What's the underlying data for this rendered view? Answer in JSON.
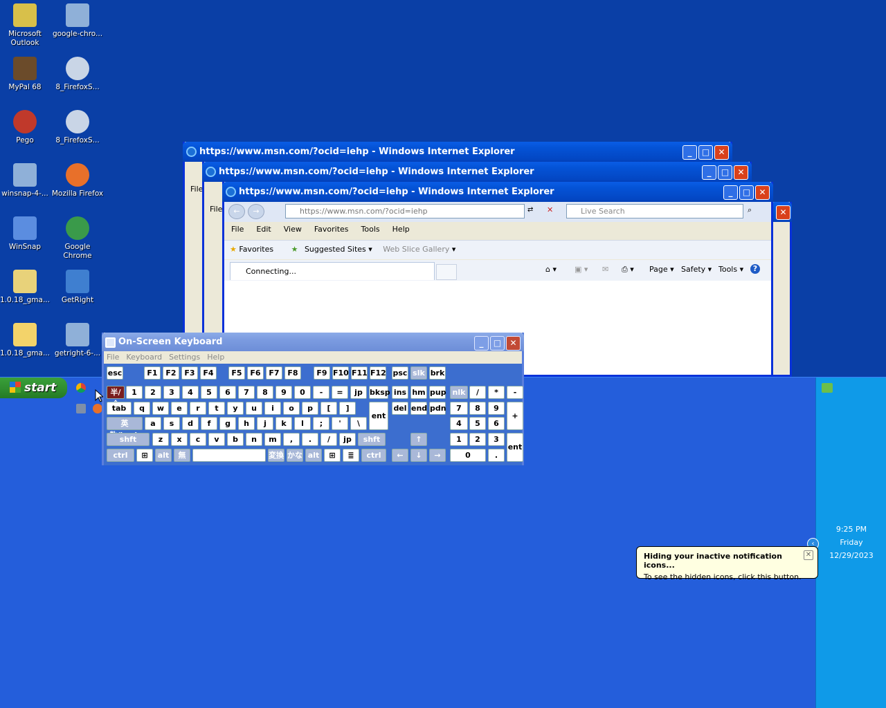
{
  "desktop": {
    "icons": [
      {
        "label": "Microsoft Outlook",
        "icon": "outlook-icon"
      },
      {
        "label": "google-chro...",
        "icon": "installer-icon"
      },
      {
        "label": "MyPal 68",
        "icon": "mypal-icon"
      },
      {
        "label": "8_FirefoxS...",
        "icon": "setup-cd-icon"
      },
      {
        "label": "Pego",
        "icon": "pego-icon"
      },
      {
        "label": "8_FirefoxS...",
        "icon": "setup-cd-icon"
      },
      {
        "label": "winsnap-4-...",
        "icon": "installer-icon"
      },
      {
        "label": "Mozilla Firefox",
        "icon": "firefox-icon"
      },
      {
        "label": "WinSnap",
        "icon": "winsnap-icon"
      },
      {
        "label": "Google Chrome",
        "icon": "chrome-icon"
      },
      {
        "label": "1.0.18_gma...",
        "icon": "archive-icon"
      },
      {
        "label": "GetRight",
        "icon": "getright-icon"
      },
      {
        "label": "1.0.18_gma...",
        "icon": "folder-icon"
      },
      {
        "label": "getright-6-...",
        "icon": "installer-icon"
      }
    ]
  },
  "ie": {
    "title": "https://www.msn.com/?ocid=iehp - Windows Internet Explorer",
    "address": "https://www.msn.com/?ocid=iehp",
    "search_placeholder": "Live Search",
    "menu": [
      "File",
      "Edit",
      "View",
      "Favorites",
      "Tools",
      "Help"
    ],
    "favorites_label": "Favorites",
    "suggested_sites": "Suggested Sites",
    "web_slice_gallery": "Web Slice Gallery",
    "tab_label": "Connecting...",
    "cmd_page": "Page",
    "cmd_safety": "Safety",
    "cmd_tools": "Tools",
    "bg_menu_file": "File"
  },
  "osk": {
    "title": "On-Screen Keyboard",
    "menu": [
      "File",
      "Keyboard",
      "Settings",
      "Help"
    ],
    "rows": [
      [
        "esc",
        "F1",
        "F2",
        "F3",
        "F4",
        "F5",
        "F6",
        "F7",
        "F8",
        "F9",
        "F10",
        "F11",
        "F12",
        "psc",
        "slk",
        "brk"
      ],
      [
        "半/全",
        "1",
        "2",
        "3",
        "4",
        "5",
        "6",
        "7",
        "8",
        "9",
        "0",
        "-",
        "=",
        "jp",
        "bksp",
        "ins",
        "hm",
        "pup",
        "nlk",
        "/",
        "*",
        "-"
      ],
      [
        "tab",
        "q",
        "w",
        "e",
        "r",
        "t",
        "y",
        "u",
        "i",
        "o",
        "p",
        "[",
        "]",
        "ent",
        "del",
        "end",
        "pdn",
        "7",
        "8",
        "9",
        "+"
      ],
      [
        "英数/Lock",
        "a",
        "s",
        "d",
        "f",
        "g",
        "h",
        "j",
        "k",
        "l",
        ";",
        "'",
        "\\",
        "4",
        "5",
        "6"
      ],
      [
        "shft",
        "z",
        "x",
        "c",
        "v",
        "b",
        "n",
        "m",
        ",",
        ".",
        "/",
        "jp",
        "shft",
        "↑",
        "1",
        "2",
        "3",
        "ent"
      ],
      [
        "ctrl",
        "⊞",
        "alt",
        "無",
        "",
        "変換",
        "かな",
        "alt",
        "⊞",
        "≣",
        "ctrl",
        "←",
        "↓",
        "→",
        "0",
        "."
      ]
    ]
  },
  "taskbar": {
    "start_label": "start"
  },
  "tray": {
    "time": "9:25 PM",
    "day": "Friday",
    "date": "12/29/2023"
  },
  "balloon": {
    "title": "Hiding your inactive notification icons...",
    "text": "To see the hidden icons, click this button."
  }
}
